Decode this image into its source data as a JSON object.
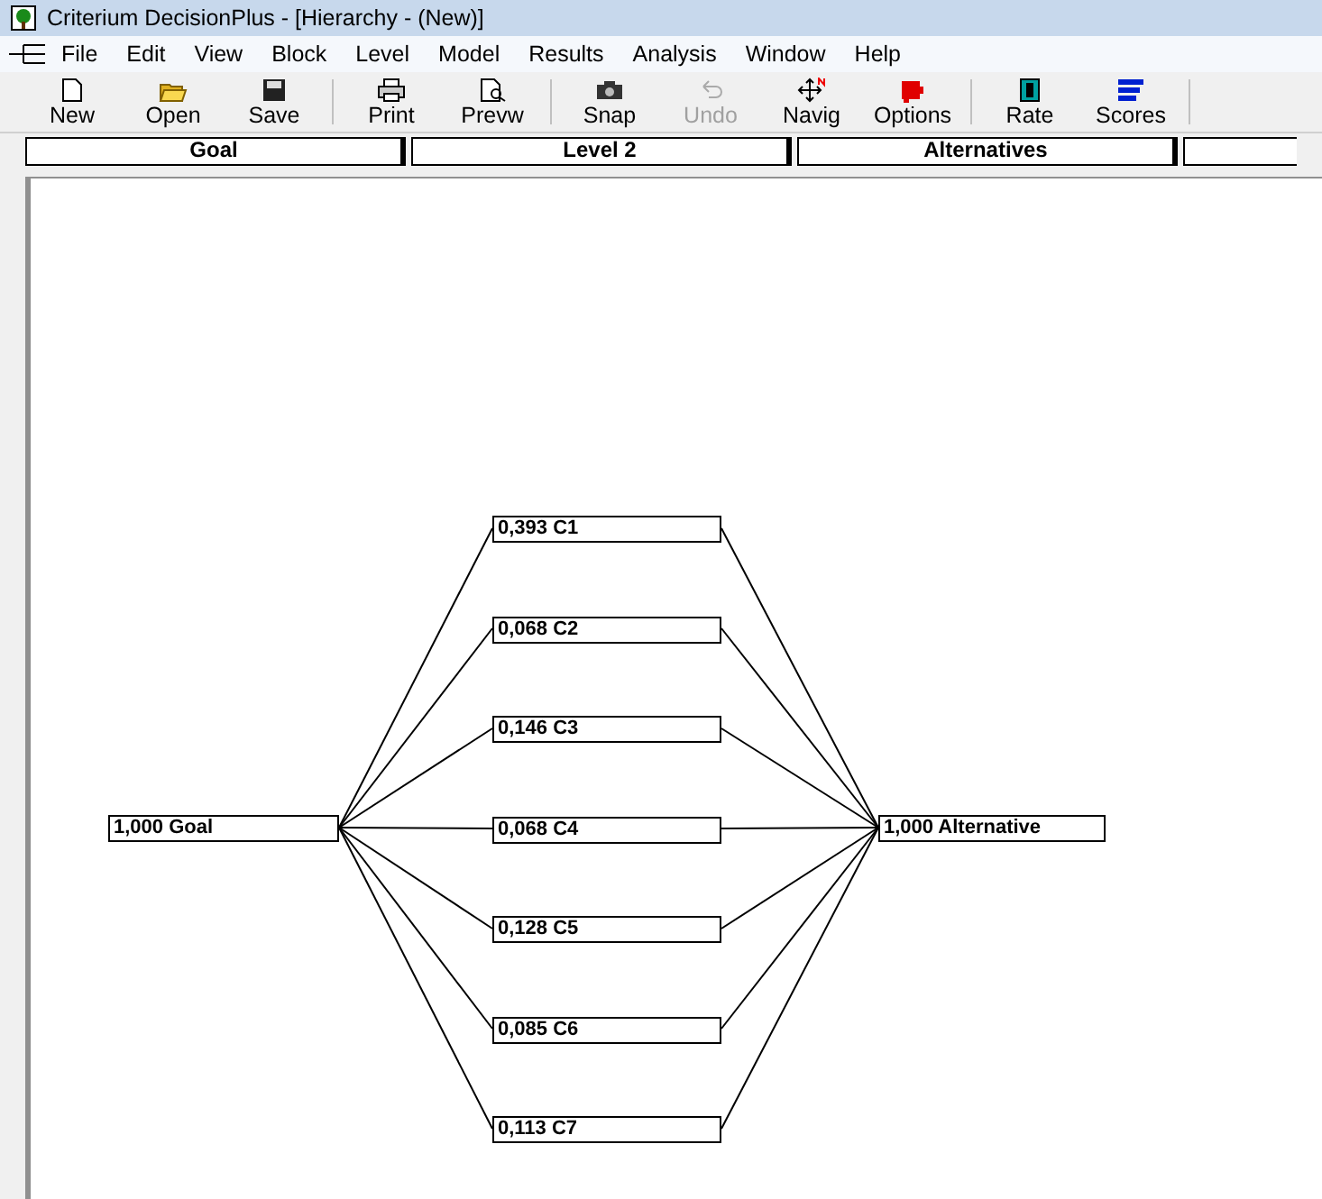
{
  "window": {
    "title": "Criterium DecisionPlus - [Hierarchy - (New)]"
  },
  "menu": [
    "File",
    "Edit",
    "View",
    "Block",
    "Level",
    "Model",
    "Results",
    "Analysis",
    "Window",
    "Help"
  ],
  "toolbar": [
    {
      "buttons": [
        {
          "kind": "new",
          "label": "New",
          "disabled": false
        },
        {
          "kind": "open",
          "label": "Open",
          "disabled": false
        },
        {
          "kind": "save",
          "label": "Save",
          "disabled": false
        }
      ]
    },
    {
      "buttons": [
        {
          "kind": "print",
          "label": "Print",
          "disabled": false
        },
        {
          "kind": "preview",
          "label": "Prevw",
          "disabled": false
        }
      ]
    },
    {
      "buttons": [
        {
          "kind": "snap",
          "label": "Snap",
          "disabled": false
        },
        {
          "kind": "undo",
          "label": "Undo",
          "disabled": true
        },
        {
          "kind": "navig",
          "label": "Navig",
          "disabled": false
        },
        {
          "kind": "options",
          "label": "Options",
          "disabled": false
        }
      ]
    },
    {
      "buttons": [
        {
          "kind": "rate",
          "label": "Rate",
          "disabled": false
        },
        {
          "kind": "scores",
          "label": "Scores",
          "disabled": false
        }
      ]
    }
  ],
  "levels": [
    "Goal",
    "Level 2",
    "Alternatives"
  ],
  "hierarchy": {
    "goal": "1,000 Goal",
    "criteria": [
      "0,393 C1",
      "0,068 C2",
      "0,146 C3",
      "0,068 C4",
      "0,128 C5",
      "0,085 C6",
      "0,113 C7"
    ],
    "alternative": "1,000 Alternative"
  }
}
